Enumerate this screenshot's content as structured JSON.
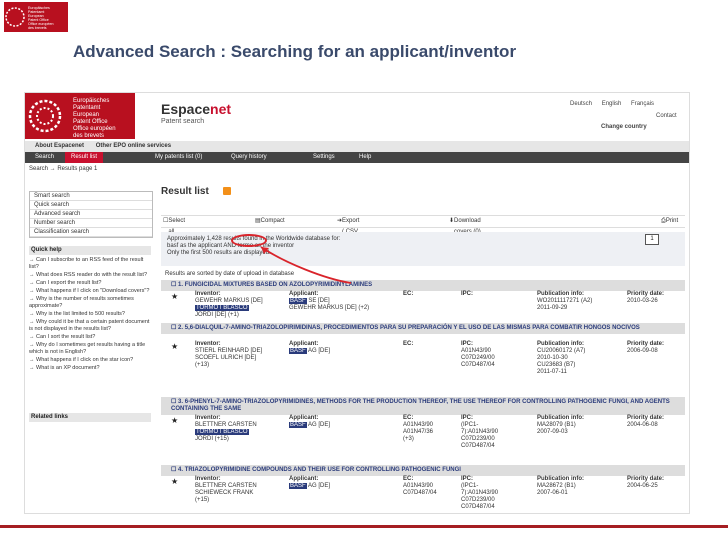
{
  "slide": {
    "title": "Advanced Search : Searching for an applicant/inventor",
    "small_logo_lines": [
      "Europäisches",
      "Patentamt",
      "European",
      "Patent Office",
      "Office européen",
      "des brevets"
    ]
  },
  "header": {
    "epo_lines": [
      "Europäisches",
      "Patentamt",
      "European",
      "Patent Office",
      "Office européen",
      "des brevets"
    ],
    "brand_main": "Espace",
    "brand_accent": "net",
    "brand_sub": "Patent search",
    "languages": [
      "Deutsch",
      "English",
      "Français"
    ],
    "contact": "Contact",
    "change_country": "Change country"
  },
  "nav1": [
    "About Espacenet",
    "Other EPO online services"
  ],
  "nav2": {
    "tabs": [
      "Search",
      "Result list",
      "My patents list (0)",
      "Query history",
      "Settings",
      "Help"
    ],
    "active_index": 1
  },
  "breadcrumb": "Search → Results page 1",
  "sidebar": {
    "search_items": [
      "Smart search",
      "Quick search",
      "Advanced search",
      "Number search",
      "Classification search"
    ],
    "quick_help_title": "Quick help",
    "quick_help_items": [
      "→ Can I subscribe to an RSS feed of the result list?",
      "→ What does RSS reader do with the result list?",
      "→ Can I export the result list?",
      "→ What happens if I click on \"Download covers\"?",
      "→ Why is the number of results sometimes approximate?",
      "→ Why is the list limited to 500 results?",
      "→ Why could it be that a certain patent document is not displayed in the results list?",
      "→ Can I sort the result list?",
      "→ Why do I sometimes get results having a title which is not in English?",
      "→ What happens if I click on the star icon?",
      "→ What is an XP document?"
    ],
    "related_links": "Related links"
  },
  "results": {
    "title": "Result list",
    "toolbar": {
      "select_all": "Select all",
      "compact": "Compact",
      "export": "Export ( CSV | XLS )",
      "download": "Download covers (0)",
      "print": "Print"
    },
    "info_lines": [
      "Approximately 1,428 results found in the Worldwide database for:",
      "basf as the applicant AND tormo as the inventor",
      "Only the first 500 results are displayed."
    ],
    "page": "1",
    "sort_note": "Results are sorted by date of upload in database",
    "column_labels": {
      "inventor": "Inventor:",
      "applicant": "Applicant:",
      "ec": "EC:",
      "ipc": "IPC:",
      "pubinfo": "Publication info:",
      "priority": "Priority date:"
    },
    "items": [
      {
        "num": "1.",
        "title": "FUNGICIDAL MIXTURES BASED ON AZOLOPYRIMIDINYLAMINES",
        "inventor": [
          "GEWEHR MARKUS [DE]",
          "TORMO I BLASCO",
          "JORDI [DE] (+1)"
        ],
        "applicant_hl": "BASF",
        "applicant": [
          "SE [DE]",
          "GEWEHR MARKUS [DE] (+2)"
        ],
        "ec": [],
        "ipc": [],
        "pubinfo": [
          "WO2011117271 (A2)",
          "2011-09-29"
        ],
        "priority": "2010-03-26"
      },
      {
        "num": "2.",
        "title": "5,6-DIALQUIL-7-AMINO-TRIAZOLOPIRIMIDINAS, PROCEDIMIENTOS PARA SU PREPARACIÓN Y EL USO DE LAS MISMAS PARA COMBATIR HONGOS NOCIVOS",
        "inventor": [
          "STIERL REINHARD [DE]",
          "SCOEFL ULRICH [DE]",
          "(+13)"
        ],
        "applicant_hl": "BASF",
        "applicant": [
          "AG [DE]"
        ],
        "ec": [],
        "ipc": [
          "A01N43/90",
          "C07D249/00",
          "C07D487/04"
        ],
        "pubinfo": [
          "CU20060172 (A7)",
          "2010-10-30",
          "CU23683 (B7)",
          "2011-07-11"
        ],
        "priority": "2006-09-08"
      },
      {
        "num": "3.",
        "title": "6-PHENYL-7-AMINO-TRIAZOLOPYRIMIDINES, METHODS FOR THE PRODUCTION THEREOF, THE USE THEREOF FOR CONTROLLING PATHOGENIC FUNGI, AND AGENTS CONTAINING THE SAME",
        "inventor": [
          "BLETTNER CARSTEN",
          "TORMO I BLASCO",
          "JORDI (+15)"
        ],
        "applicant_hl": "BASF",
        "applicant": [
          "AG [DE]"
        ],
        "ec": [
          "A01N43/90",
          "A01N47/36",
          "(+3)"
        ],
        "ipc": [
          "(IPC1-",
          "7):A01N43/90",
          "C07D239/00",
          "C07D487/04"
        ],
        "pubinfo": [
          "MA28079 (B1)",
          "2007-09-03"
        ],
        "priority": "2004-06-08"
      },
      {
        "num": "4.",
        "title": "TRIAZOLOPYRIMIDINE COMPOUNDS AND THEIR USE FOR CONTROLLING PATHOGENIC FUNGI",
        "inventor": [
          "BLETTNER CARSTEN",
          "SCHIEWECK FRANK",
          "(+15)"
        ],
        "applicant_hl": "BASF",
        "applicant": [
          "AG [DE]"
        ],
        "ec": [
          "A01N43/90",
          "C07D487/04"
        ],
        "ipc": [
          "(IPC1-",
          "7):A01N43/90",
          "C07D239/00",
          "C07D487/04"
        ],
        "pubinfo": [
          "MA28672 (B1)",
          "2007-06-01"
        ],
        "priority": "2004-06-25"
      }
    ]
  }
}
